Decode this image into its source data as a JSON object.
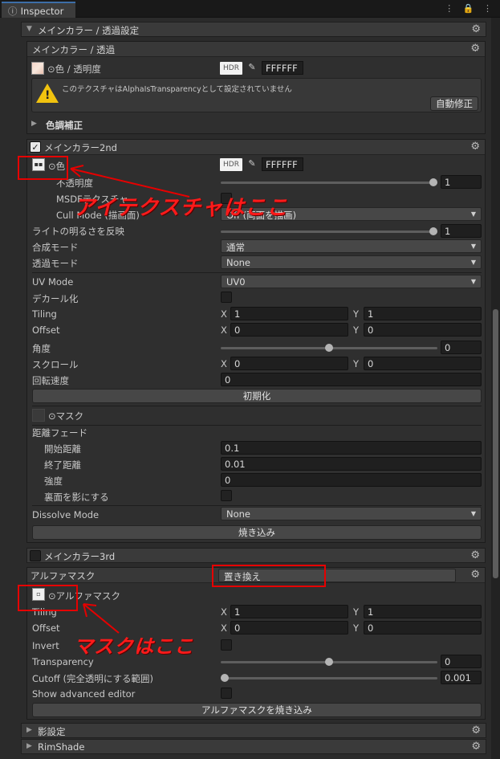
{
  "window": {
    "tab_label": "Inspector",
    "menu_icons": "⋮ 🔒 ⋮"
  },
  "sections": {
    "main_color_alpha": {
      "title": "メインカラー / 透過設定"
    },
    "main_color": {
      "title": "メインカラー / 透過",
      "color_label": "⊙色 / 透明度",
      "hdr": "HDR",
      "hex": "FFFFFF",
      "warning": "このテクスチャはAlphaIsTransparencyとして設定されていません",
      "auto_fix": "自動修正",
      "color_correction": "色調補正"
    },
    "main_color_2nd": {
      "title": "メインカラー2nd",
      "color_label": "⊙色",
      "hdr": "HDR",
      "hex": "FFFFFF",
      "opacity_label": "不透明度",
      "opacity_value": "1",
      "opacity_fraction": 1.0,
      "msdf_label": "MSDFテクスチャ",
      "cull_label": "Cull Mode (描画面)",
      "cull_value": "Off (両面を描画)",
      "light_label": "ライトの明るさを反映",
      "light_value": "1",
      "light_fraction": 1.0,
      "blend_label": "合成モード",
      "blend_value": "通常",
      "trans_label": "透過モード",
      "trans_value": "None",
      "uv_label": "UV Mode",
      "uv_value": "UV0",
      "decal_label": "デカール化",
      "tiling_label": "Tiling",
      "tiling_x": "1",
      "tiling_y": "1",
      "offset_label": "Offset",
      "offset_x": "0",
      "offset_y": "0",
      "angle_label": "角度",
      "angle_value": "0",
      "angle_fraction": 0.5,
      "scroll_label": "スクロール",
      "scroll_x": "0",
      "scroll_y": "0",
      "rot_label": "回転速度",
      "rot_value": "0",
      "reset_button": "初期化",
      "mask_label": "⊙マスク",
      "distfade_label": "距離フェード",
      "start_label": "開始距離",
      "start_value": "0.1",
      "end_label": "終了距離",
      "end_value": "0.01",
      "strength_label": "強度",
      "strength_value": "0",
      "backface_label": "裏面を影にする",
      "dissolve_label": "Dissolve Mode",
      "dissolve_value": "None",
      "bake_button": "焼き込み"
    },
    "main_color_3rd": {
      "title": "メインカラー3rd"
    },
    "alpha_mask": {
      "title": "アルファマスク",
      "mode_value": "置き換え",
      "mask_label": "⊙アルファマスク",
      "tiling_label": "Tiling",
      "tiling_x": "1",
      "tiling_y": "1",
      "offset_label": "Offset",
      "offset_x": "0",
      "offset_y": "0",
      "invert_label": "Invert",
      "transparency_label": "Transparency",
      "transparency_value": "0",
      "transparency_fraction": 0.5,
      "cutoff_label": "Cutoff (完全透明にする範囲)",
      "cutoff_value": "0.001",
      "cutoff_fraction": 0.0,
      "advanced_label": "Show advanced editor",
      "bake_button": "アルファマスクを焼き込み"
    },
    "shadow": {
      "title": "影設定"
    },
    "rimshade": {
      "title": "RimShade"
    }
  },
  "annotations": {
    "texture_note": "アイテクスチャはここ",
    "mask_note": "マスクはここ"
  },
  "xy": {
    "x": "X",
    "y": "Y"
  },
  "colors": {
    "annotation": "#e60000",
    "accent": "#3d6ea8",
    "warning": "#f1c30f"
  }
}
